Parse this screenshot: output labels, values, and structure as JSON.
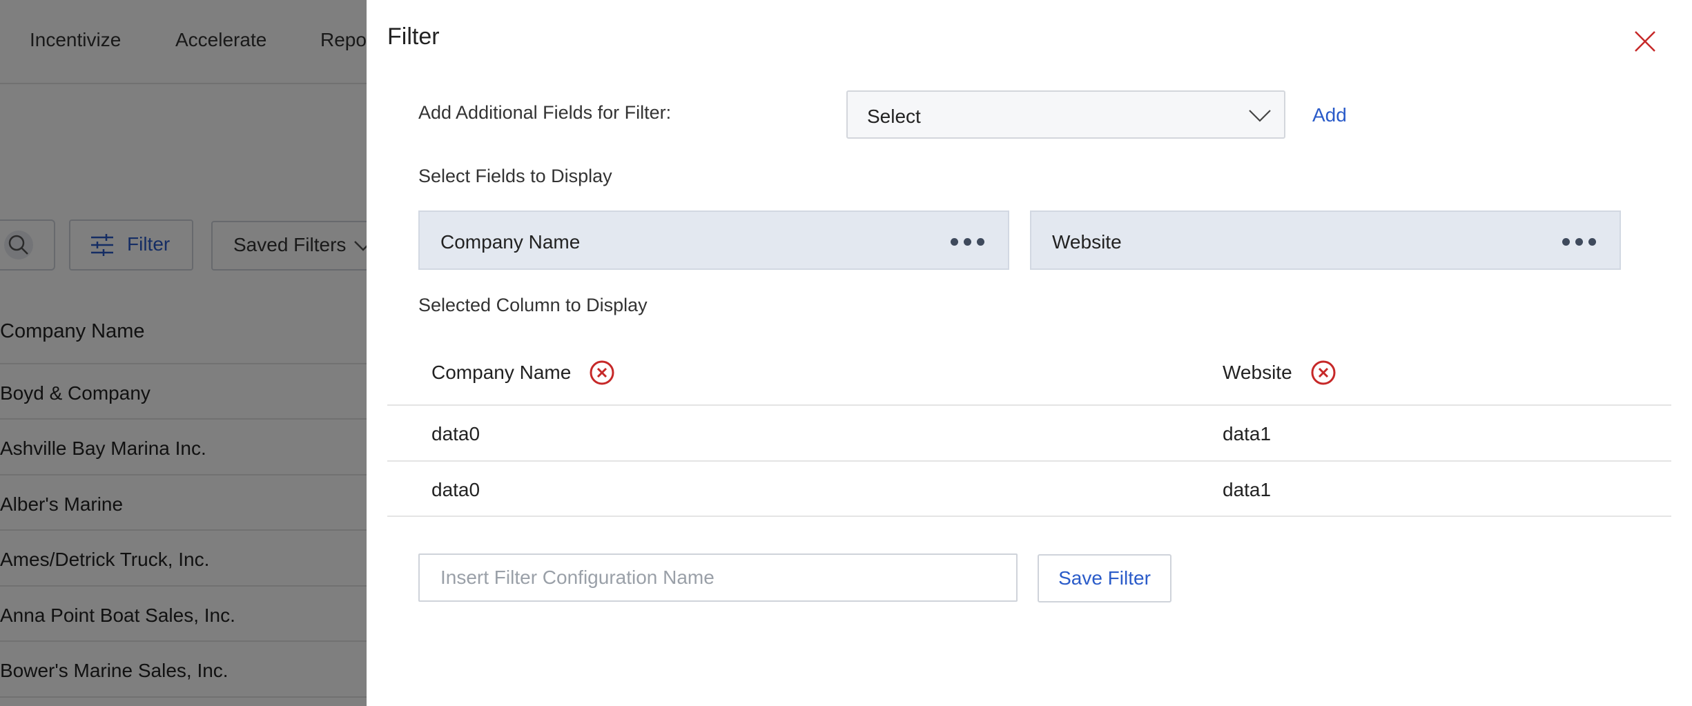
{
  "background": {
    "nav": [
      "Incentivize",
      "Accelerate",
      "Repo"
    ],
    "filter_label": "Filter",
    "saved_filters_label": "Saved Filters",
    "column_header": "Company Name",
    "rows": [
      "Boyd & Company",
      "Ashville Bay Marina Inc.",
      "Alber's Marine",
      "Ames/Detrick Truck, Inc.",
      "Anna Point Boat Sales, Inc.",
      "Bower's Marine Sales, Inc."
    ]
  },
  "drawer": {
    "title": "Filter",
    "close_icon": "close-icon",
    "add_fields_label": "Add Additional Fields for Filter:",
    "select_value": "Select",
    "add_label": "Add",
    "fields_label": "Select Fields to Display",
    "fields": [
      "Company Name",
      "Website"
    ],
    "selected_label": "Selected Column to Display",
    "columns": [
      "Company Name",
      "Website"
    ],
    "rows": [
      [
        "data0",
        "data1"
      ],
      [
        "data0",
        "data1"
      ]
    ],
    "name_placeholder": "Insert Filter Configuration Name",
    "save_label": "Save Filter"
  },
  "colors": {
    "accent": "#2a5bc9",
    "remove": "#c62828",
    "chip_bg": "#e3e8f0"
  }
}
